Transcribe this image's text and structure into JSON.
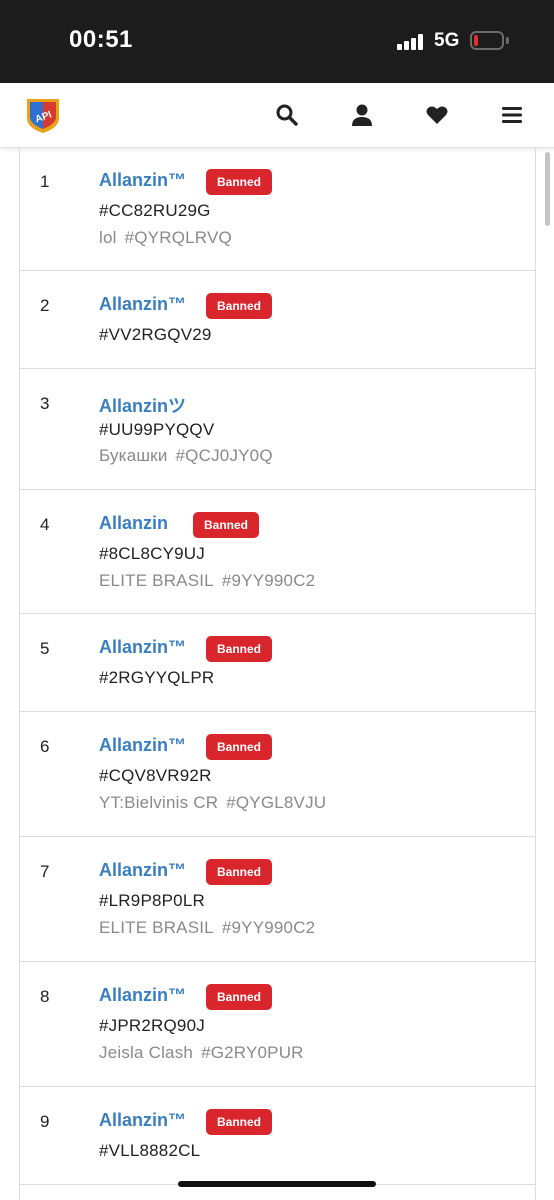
{
  "status_bar": {
    "time": "00:51",
    "network": "5G",
    "battery_color": "#e0302e"
  },
  "header": {
    "logo_text": "API",
    "icons": [
      "search-icon",
      "user-icon",
      "heart-icon",
      "menu-icon"
    ]
  },
  "players": [
    {
      "rank": "1",
      "name": "Allanzin™",
      "banned": "Banned",
      "tag": "#CC82RU29G",
      "clan": "lol",
      "clan_tag": "#QYRQLRVQ"
    },
    {
      "rank": "2",
      "name": "Allanzin™",
      "banned": "Banned",
      "tag": "#VV2RGQV29",
      "clan": "",
      "clan_tag": ""
    },
    {
      "rank": "3",
      "name": "Allanzinツ",
      "banned": "",
      "tag": "#UU99PYQQV",
      "clan": "Букашки",
      "clan_tag": "#QCJ0JY0Q"
    },
    {
      "rank": "4",
      "name": "Allanzin",
      "banned": "Banned",
      "tag": "#8CL8CY9UJ",
      "clan": "ELITE BRASIL",
      "clan_tag": "#9YY990C2"
    },
    {
      "rank": "5",
      "name": "Allanzin™",
      "banned": "Banned",
      "tag": "#2RGYYQLPR",
      "clan": "",
      "clan_tag": ""
    },
    {
      "rank": "6",
      "name": "Allanzin™",
      "banned": "Banned",
      "tag": "#CQV8VR92R",
      "clan": "YT:Bielvinis CR",
      "clan_tag": "#QYGL8VJU"
    },
    {
      "rank": "7",
      "name": "Allanzin™",
      "banned": "Banned",
      "tag": "#LR9P8P0LR",
      "clan": "ELITE BRASIL",
      "clan_tag": "#9YY990C2"
    },
    {
      "rank": "8",
      "name": "Allanzin™",
      "banned": "Banned",
      "tag": "#JPR2RQ90J",
      "clan": "Jeisla Clash",
      "clan_tag": "#G2RY0PUR"
    },
    {
      "rank": "9",
      "name": "Allanzin™",
      "banned": "Banned",
      "tag": "#VLL8882CL",
      "clan": "",
      "clan_tag": ""
    }
  ],
  "colors": {
    "link_blue": "#3a7fc1",
    "banned_red": "#d9262c",
    "muted_gray": "#8a8a8a"
  }
}
